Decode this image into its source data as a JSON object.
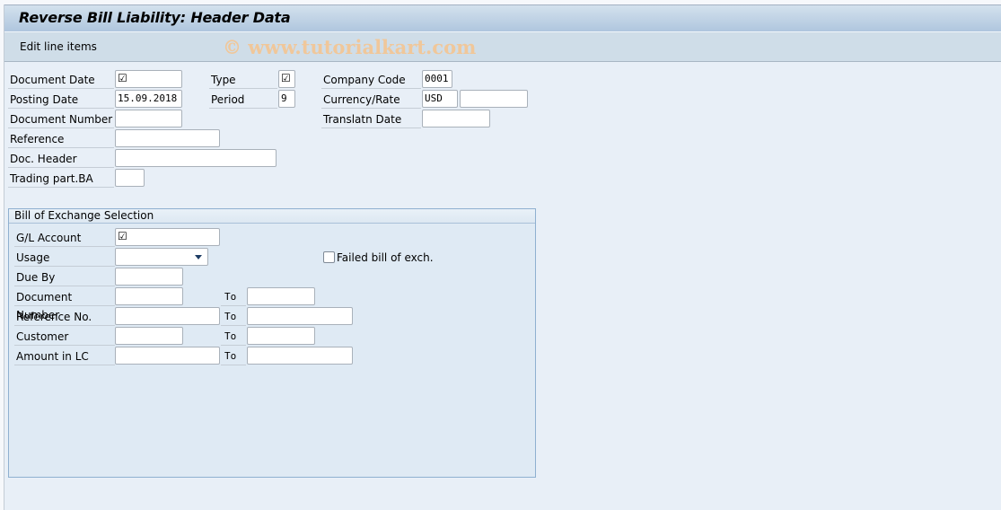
{
  "title": "Reverse Bill Liability: Header Data",
  "toolbar": {
    "edit_line_items": "Edit line items"
  },
  "watermark": "© www.tutorialkart.com",
  "header": {
    "document_date": {
      "label": "Document Date",
      "value": "☑"
    },
    "type": {
      "label": "Type",
      "value": "☑"
    },
    "company_code": {
      "label": "Company Code",
      "value": "0001"
    },
    "posting_date": {
      "label": "Posting Date",
      "value": "15.09.2018"
    },
    "period": {
      "label": "Period",
      "value": "9"
    },
    "currency_rate": {
      "label": "Currency/Rate",
      "currency": "USD",
      "rate": ""
    },
    "document_number": {
      "label": "Document Number",
      "value": ""
    },
    "translatn_date": {
      "label": "Translatn Date",
      "value": ""
    },
    "reference": {
      "label": "Reference",
      "value": ""
    },
    "doc_header": {
      "label": "Doc. Header",
      "value": ""
    },
    "trading_part_ba": {
      "label": "Trading part.BA",
      "value": ""
    }
  },
  "selection": {
    "title": "Bill of Exchange Selection",
    "to_label": "To",
    "gl_account": {
      "label": "G/L Account",
      "value": "☑"
    },
    "usage": {
      "label": "Usage",
      "value": ""
    },
    "failed_bill": {
      "label": "Failed bill of exch.",
      "checked": false
    },
    "due_by": {
      "label": "Due By",
      "value": ""
    },
    "document_number": {
      "label": "Document Number",
      "from": "",
      "to": ""
    },
    "reference_no": {
      "label": "Reference No.",
      "from": "",
      "to": ""
    },
    "customer": {
      "label": "Customer",
      "from": "",
      "to": ""
    },
    "amount_in_lc": {
      "label": "Amount in LC",
      "from": "",
      "to": ""
    }
  }
}
